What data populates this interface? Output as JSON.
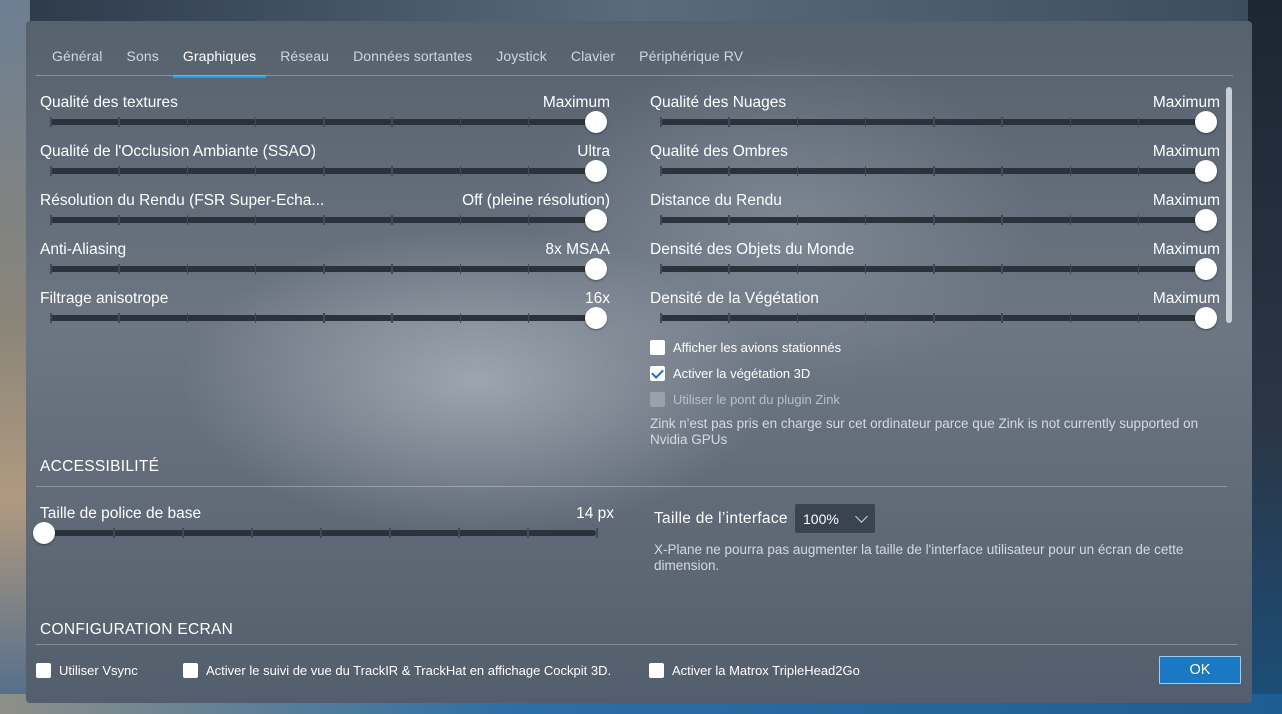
{
  "tabs": [
    {
      "label": "Général"
    },
    {
      "label": "Sons"
    },
    {
      "label": "Graphiques",
      "active": true
    },
    {
      "label": "Réseau"
    },
    {
      "label": "Données sortantes"
    },
    {
      "label": "Joystick"
    },
    {
      "label": "Clavier"
    },
    {
      "label": "Périphérique  RV"
    }
  ],
  "left_settings": [
    {
      "label": "Qualité des textures",
      "value": "Maximum",
      "level": 1.0
    },
    {
      "label": "Qualité de l'Occlusion Ambiante (SSAO)",
      "value": "Ultra",
      "level": 1.0
    },
    {
      "label": "Résolution du Rendu (FSR Super-Echa...",
      "value": "Off (pleine résolution)",
      "level": 1.0
    },
    {
      "label": "Anti-Aliasing",
      "value": "8x MSAA",
      "level": 1.0
    },
    {
      "label": "Filtrage anisotrope",
      "value": "16x",
      "level": 1.0
    }
  ],
  "right_settings": [
    {
      "label": "Qualité des Nuages",
      "value": "Maximum",
      "level": 1.0
    },
    {
      "label": "Qualité des Ombres",
      "value": "Maximum",
      "level": 1.0
    },
    {
      "label": "Distance du Rendu",
      "value": "Maximum",
      "level": 1.0
    },
    {
      "label": "Densité des Objets du Monde",
      "value": "Maximum",
      "level": 1.0
    },
    {
      "label": "Densité de la Végétation",
      "value": "Maximum",
      "level": 1.0
    }
  ],
  "options": {
    "parked": {
      "label": "Afficher les avions stationnés",
      "checked": false
    },
    "vegetation3d": {
      "label": "Activer la végétation 3D",
      "checked": true
    },
    "zink": {
      "label": "Utiliser le pont du plugin Zink",
      "checked": false,
      "disabled": true
    },
    "zink_note": "Zink n'est pas pris en charge sur cet ordinateur parce que Zink is not currently supported on Nvidia GPUs"
  },
  "accessibility": {
    "title": "ACCESSIBILITÉ",
    "font_label": "Taille de police de base",
    "font_value": "14 px",
    "font_level": 0.0,
    "ui_size_label": "Taille de l’interface",
    "ui_size_value": "100%",
    "ui_note": "X-Plane ne pourra pas augmenter la taille de l'interface utilisateur pour un écran de cette dimension."
  },
  "screen_config_title": "CONFIGURATION ECRAN",
  "bottom": {
    "vsync": {
      "label": "Utiliser Vsync",
      "checked": false
    },
    "trackir": {
      "label": "Activer le suivi de vue du TrackIR & TrackHat en affichage Cockpit 3D.",
      "checked": false
    },
    "matrox": {
      "label": "Activer la Matrox TripleHead2Go",
      "checked": false
    },
    "ok_label": "OK"
  },
  "colors": {
    "accent": "#1ea0e6",
    "ok_button": "#1b78c2",
    "check": "#1e73c8"
  }
}
